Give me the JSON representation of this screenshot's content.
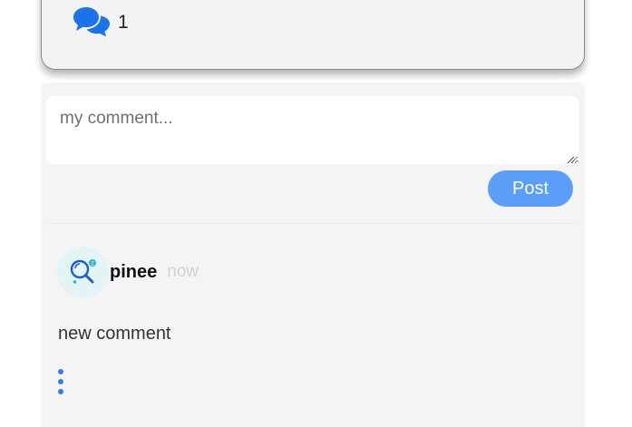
{
  "post": {
    "comment_count": "1",
    "comment_icon": "comments-icon"
  },
  "composer": {
    "placeholder": "my comment...",
    "value": "",
    "post_label": "Post"
  },
  "comments": [
    {
      "author": "pinee",
      "time": "now",
      "avatar_icon": "magnifier-avatar-icon",
      "body": "new comment",
      "menu_icon": "more-vertical-icon"
    }
  ],
  "colors": {
    "accent": "#5b9ef7",
    "icon_blue": "#1a73e8",
    "menu_blue": "#2f80ed",
    "avatar_bg": "#e3f4f5"
  }
}
